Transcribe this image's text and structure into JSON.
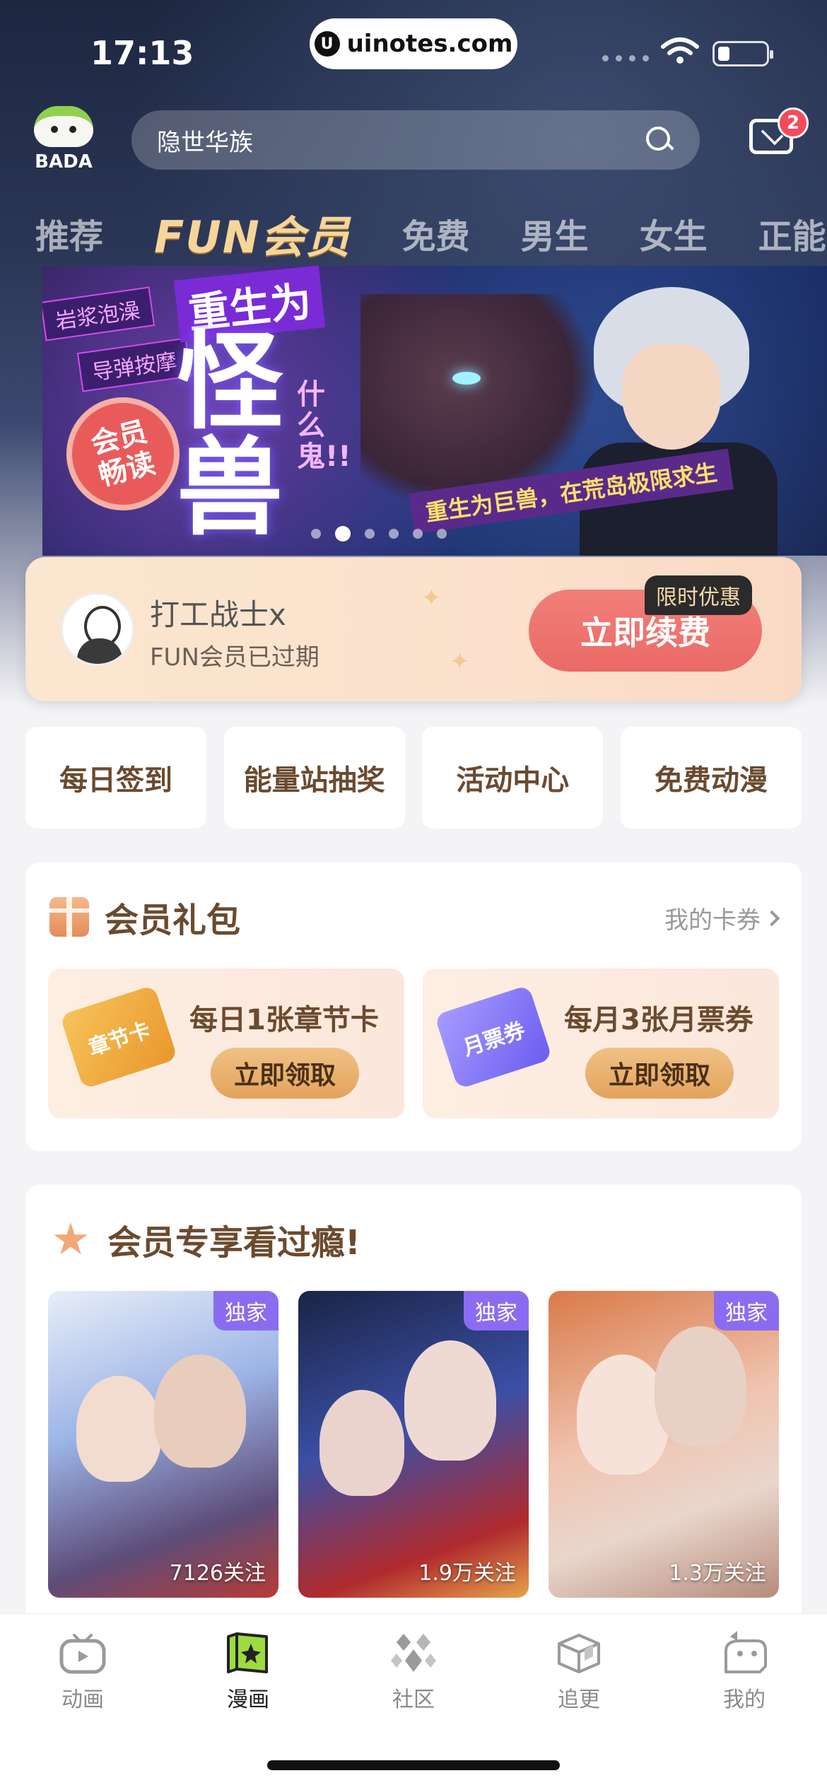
{
  "status_bar": {
    "time": "17:13",
    "url": "uinotes.com"
  },
  "header": {
    "logo_text": "BADA",
    "search_placeholder": "隐世华族",
    "mail_badge_count": "2"
  },
  "tabs": [
    {
      "label": "推荐",
      "active": false
    },
    {
      "label": "FUN会员",
      "active": true
    },
    {
      "label": "免费",
      "active": false
    },
    {
      "label": "男生",
      "active": false
    },
    {
      "label": "女生",
      "active": false
    },
    {
      "label": "正能",
      "active": false
    }
  ],
  "banner": {
    "tags": [
      "岩浆泡澡",
      "导弹按摩"
    ],
    "title_top": "重生为",
    "title_big": "怪兽",
    "title_side": "什么鬼!!",
    "seal": [
      "会员",
      "畅读"
    ],
    "subtitle": "重生为巨兽，在荒岛极限求生",
    "dot_count": 6,
    "active_dot": 1
  },
  "member": {
    "name": "打工战士x",
    "status": "FUN会员已过期",
    "renew_label": "立即续费",
    "renew_badge": "限时优惠"
  },
  "quick_links": [
    "每日签到",
    "能量站抽奖",
    "活动中心",
    "免费动漫"
  ],
  "gift_section": {
    "title": "会员礼包",
    "my_coupons": "我的卡券",
    "cards": [
      {
        "coupon_label": "章节卡",
        "desc": "每日1张章节卡",
        "button": "立即领取"
      },
      {
        "coupon_label": "月票券",
        "desc": "每月3张月票券",
        "button": "立即领取"
      }
    ]
  },
  "exclusive_section": {
    "title": "会员专享看过瘾!",
    "comics": [
      {
        "badge": "独家",
        "follows": "7126关注"
      },
      {
        "badge": "独家",
        "follows": "1.9万关注"
      },
      {
        "badge": "独家",
        "follows": "1.3万关注"
      }
    ]
  },
  "bottom_nav": [
    {
      "label": "动画",
      "icon": "tv-icon",
      "active": false
    },
    {
      "label": "漫画",
      "icon": "comic-book-icon",
      "active": true
    },
    {
      "label": "社区",
      "icon": "community-diamonds-icon",
      "active": false
    },
    {
      "label": "追更",
      "icon": "box-icon",
      "active": false
    },
    {
      "label": "我的",
      "icon": "profile-mascot-icon",
      "active": false
    }
  ],
  "colors": {
    "accent_red": "#EA6A66",
    "brown_text": "#6B4A2E",
    "exclusive_purple": "#8B6CF0",
    "active_nav": "#9DDB3E"
  }
}
